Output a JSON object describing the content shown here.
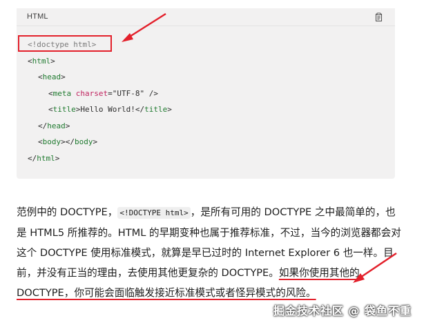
{
  "code_block": {
    "language": "HTML",
    "copy_icon": "copy-icon",
    "lines": {
      "doctype": "<!doctype html>",
      "l1_open": "<",
      "l1_tag": "html",
      "l1_close": ">",
      "l2_open": "<",
      "l2_tag": "head",
      "l2_close": ">",
      "l3_open": "<",
      "l3_tag": "meta",
      "l3_attr": "charset",
      "l3_eq": "=",
      "l3_val": "\"UTF-8\"",
      "l3_close": " />",
      "l4_open": "<",
      "l4_tag": "title",
      "l4_close": ">",
      "l4_text": "Hello World!",
      "l4_end_open": "</",
      "l4_end_tag": "title",
      "l4_end_close": ">",
      "l5_open": "</",
      "l5_tag": "head",
      "l5_close": ">",
      "l6_open": "<",
      "l6_tag": "body",
      "l6_mid": "></",
      "l6_tag2": "body",
      "l6_close": ">",
      "l7_open": "</",
      "l7_tag": "html",
      "l7_close": ">"
    }
  },
  "paragraph": {
    "p1": "范例中的 DOCTYPE，",
    "code": "<!DOCTYPE html>",
    "p2": "，是所有可用的 DOCTYPE 之中最简单的，也是 HTML5 所推荐的。HTML 的早期变种也属于推荐标准，不过，当今的浏览器都会对这个 DOCTYPE 使用标准模式，就算是早已过时的 Internet Explorer 6 也一样。目前，并没有正当的理由，去使用其他更复杂的 DOCTYPE。",
    "highlight": "如果你使用其他的 DOCTYPE，你可能会面临触发接近标准模式或者怪异模式的风险。"
  },
  "watermark": "掘金技术社区 @ 袋鱼不重",
  "colors": {
    "annotation_red": "#e3202b",
    "tag_green": "#1f7a2f",
    "attr_pink": "#c0245f",
    "code_bg": "#f2f1f1"
  }
}
